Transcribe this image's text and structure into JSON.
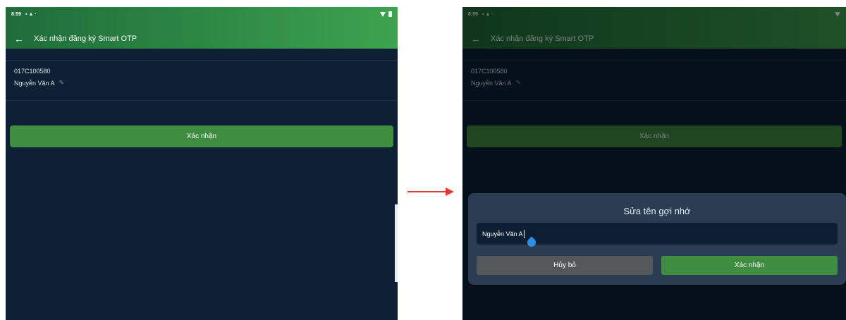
{
  "left": {
    "status_time": "8:59",
    "title": "Xác nhận đăng ký Smart OTP",
    "account": "017C100580",
    "name": "Nguyễn Văn A",
    "confirm_label": "Xác nhận"
  },
  "right": {
    "status_time": "8:59",
    "title": "Xác nhận đăng ký Smart OTP",
    "account": "017C100580",
    "name": "Nguyễn Văn A",
    "confirm_label": "Xác nhận",
    "dialog": {
      "title": "Sửa tên gợi nhớ",
      "input_value": "Nguyễn Văn A",
      "cancel_label": "Hủy bỏ",
      "confirm_label": "Xác nhận"
    }
  },
  "colors": {
    "appbar_green": "#2e8a45",
    "background": "#0d2034",
    "button_green": "#3f8d40",
    "dialog_bg": "#2b3d52",
    "cancel_gray": "#55585b",
    "arrow_red": "#e53935"
  },
  "icons": {
    "back": "arrow-left-icon",
    "edit": "pencil-icon",
    "signal": "signal-icon",
    "battery": "battery-icon"
  }
}
